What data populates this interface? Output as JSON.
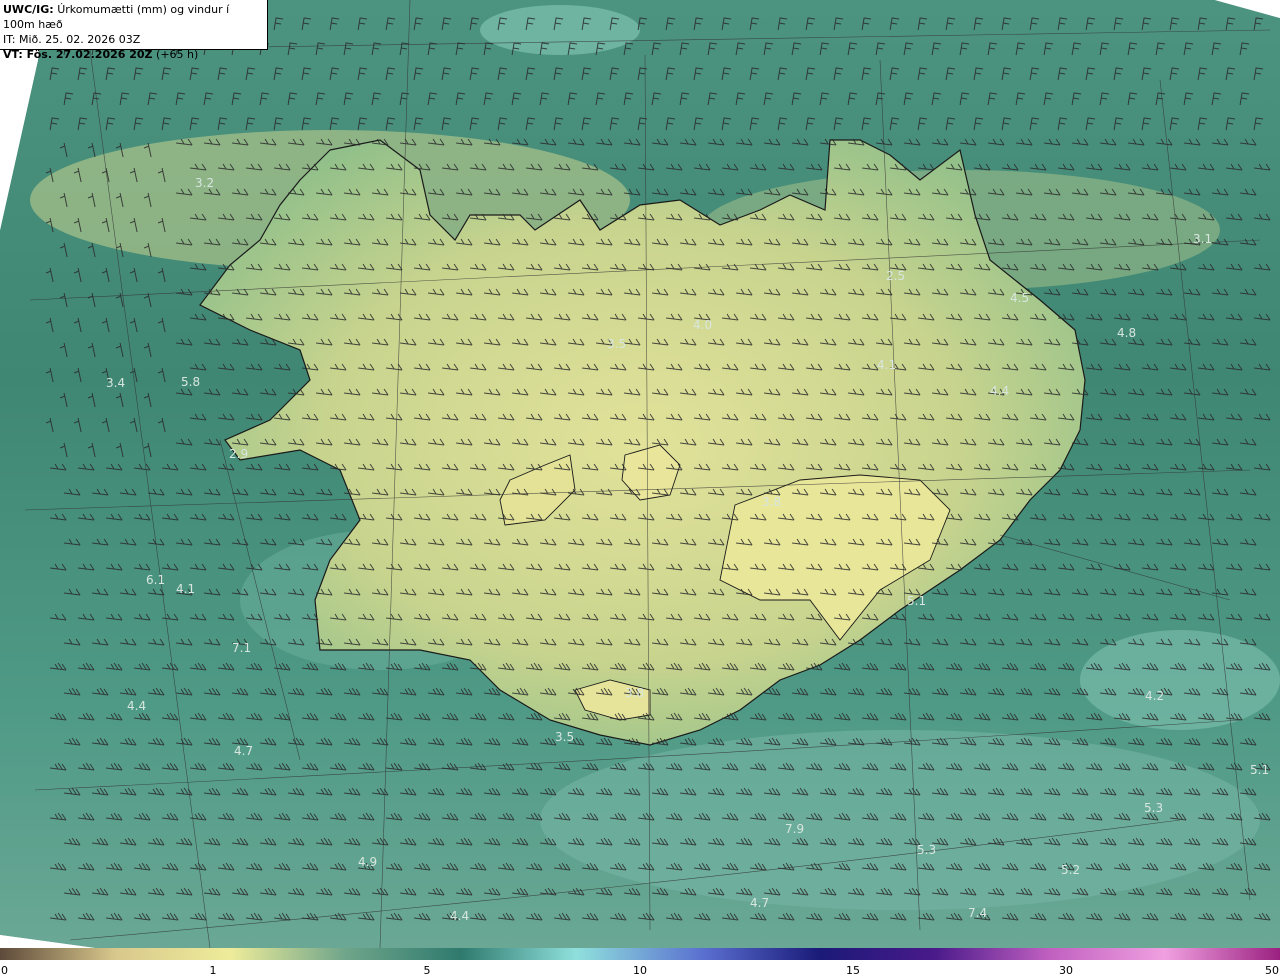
{
  "header": {
    "model": "UWC/IG:",
    "title": "Úrkomumætti (mm) og vindur í 100m hæð",
    "init_time": "IT: Mið. 25. 02. 2026 03Z",
    "valid_prefix": "VT: Fös. 27.02.2026 20Z",
    "valid_suffix": " (+65 h)"
  },
  "colorbar": {
    "ticks": [
      "0",
      "1",
      "5",
      "10",
      "15",
      "30",
      "50"
    ],
    "colors": [
      "#5e4a3a",
      "#d8c88c",
      "#eeec9a",
      "#6fa58a",
      "#2f7a6e",
      "#8fe0dc",
      "#5a6fd0",
      "#1a1a78",
      "#4a1a8a",
      "#c060c0",
      "#f0a0e0",
      "#9a2080"
    ]
  },
  "map_labels": [
    {
      "text": "3.2"
    },
    {
      "text": "3.1"
    },
    {
      "text": "2.5"
    },
    {
      "text": "4.5"
    },
    {
      "text": "4.8"
    },
    {
      "text": "4.1"
    },
    {
      "text": "4.4"
    },
    {
      "text": "3.5"
    },
    {
      "text": "4.0"
    },
    {
      "text": "3.4"
    },
    {
      "text": "5.8"
    },
    {
      "text": "2.9"
    },
    {
      "text": "3.8"
    },
    {
      "text": "6.1"
    },
    {
      "text": "4.1"
    },
    {
      "text": "5.1"
    },
    {
      "text": "7.1"
    },
    {
      "text": "4.4"
    },
    {
      "text": "4.7"
    },
    {
      "text": "3.8"
    },
    {
      "text": "3.5"
    },
    {
      "text": "4.2"
    },
    {
      "text": "5.1"
    },
    {
      "text": "5.3"
    },
    {
      "text": "7.9"
    },
    {
      "text": "5.3"
    },
    {
      "text": "4.9"
    },
    {
      "text": "5.2"
    },
    {
      "text": "4.7"
    },
    {
      "text": "7.4"
    },
    {
      "text": "4.4"
    }
  ],
  "legend_icon": "wind-barb-icon"
}
